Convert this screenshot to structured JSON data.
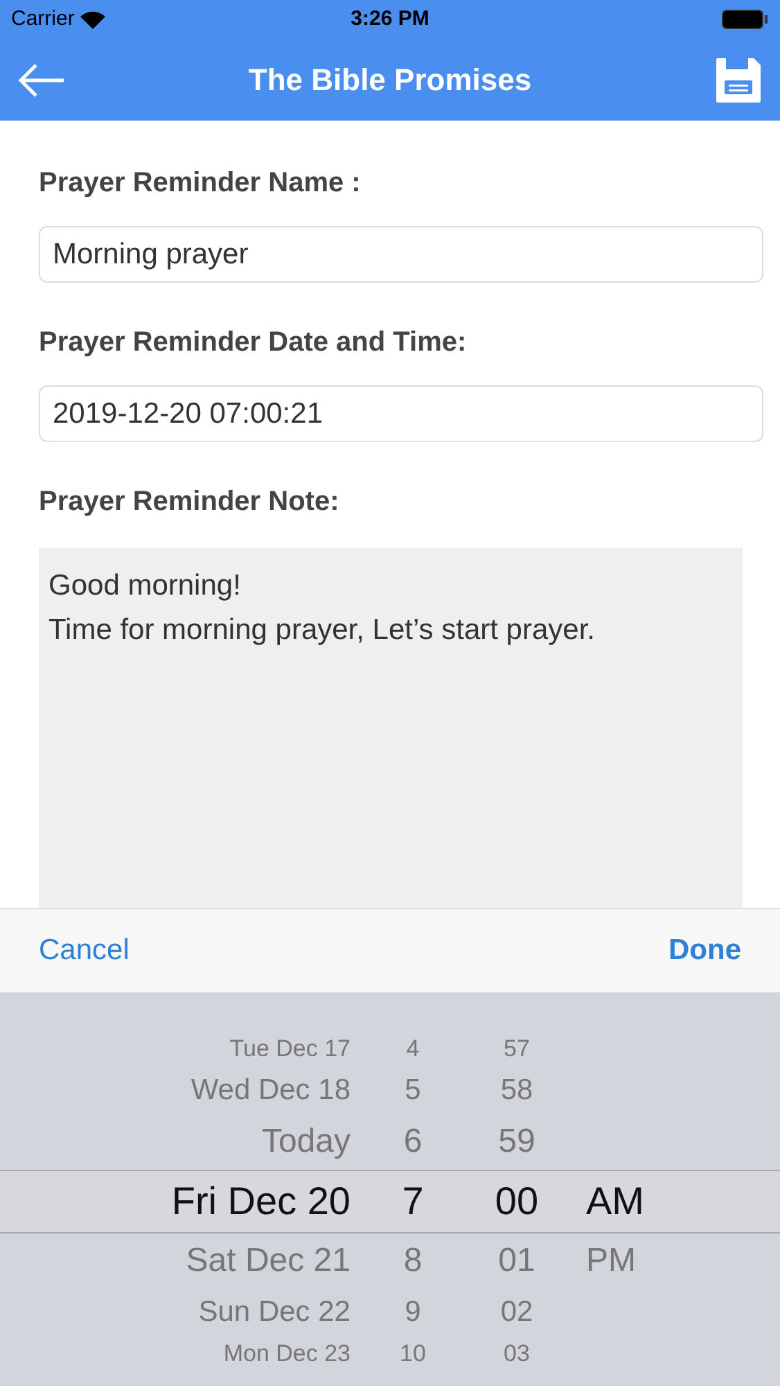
{
  "status_bar": {
    "carrier": "Carrier",
    "time": "3:26 PM"
  },
  "nav": {
    "title": "The Bible Promises"
  },
  "form": {
    "name_label": "Prayer Reminder Name :",
    "name_value": "Morning prayer",
    "date_label": "Prayer Reminder Date and Time:",
    "date_value": "2019-12-20 07:00:21",
    "note_label": "Prayer Reminder Note:",
    "note_lines": [
      "Good morning!",
      "Time for morning prayer, Let’s start prayer."
    ]
  },
  "toolbar": {
    "cancel": "Cancel",
    "done": "Done"
  },
  "picker": {
    "rows": [
      {
        "date": "Tue Dec 17",
        "hour": "4",
        "minute": "57",
        "selected": false
      },
      {
        "date": "Wed Dec 18",
        "hour": "5",
        "minute": "58",
        "selected": false
      },
      {
        "date": "Today",
        "hour": "6",
        "minute": "59",
        "selected": false
      },
      {
        "date": "Fri Dec 20",
        "hour": "7",
        "minute": "00",
        "period": "AM",
        "selected": true
      },
      {
        "date": "Sat Dec 21",
        "hour": "8",
        "minute": "01",
        "period": "PM",
        "selected": false
      },
      {
        "date": "Sun Dec 22",
        "hour": "9",
        "minute": "02",
        "selected": false
      },
      {
        "date": "Mon Dec 23",
        "hour": "10",
        "minute": "03",
        "selected": false
      }
    ]
  }
}
